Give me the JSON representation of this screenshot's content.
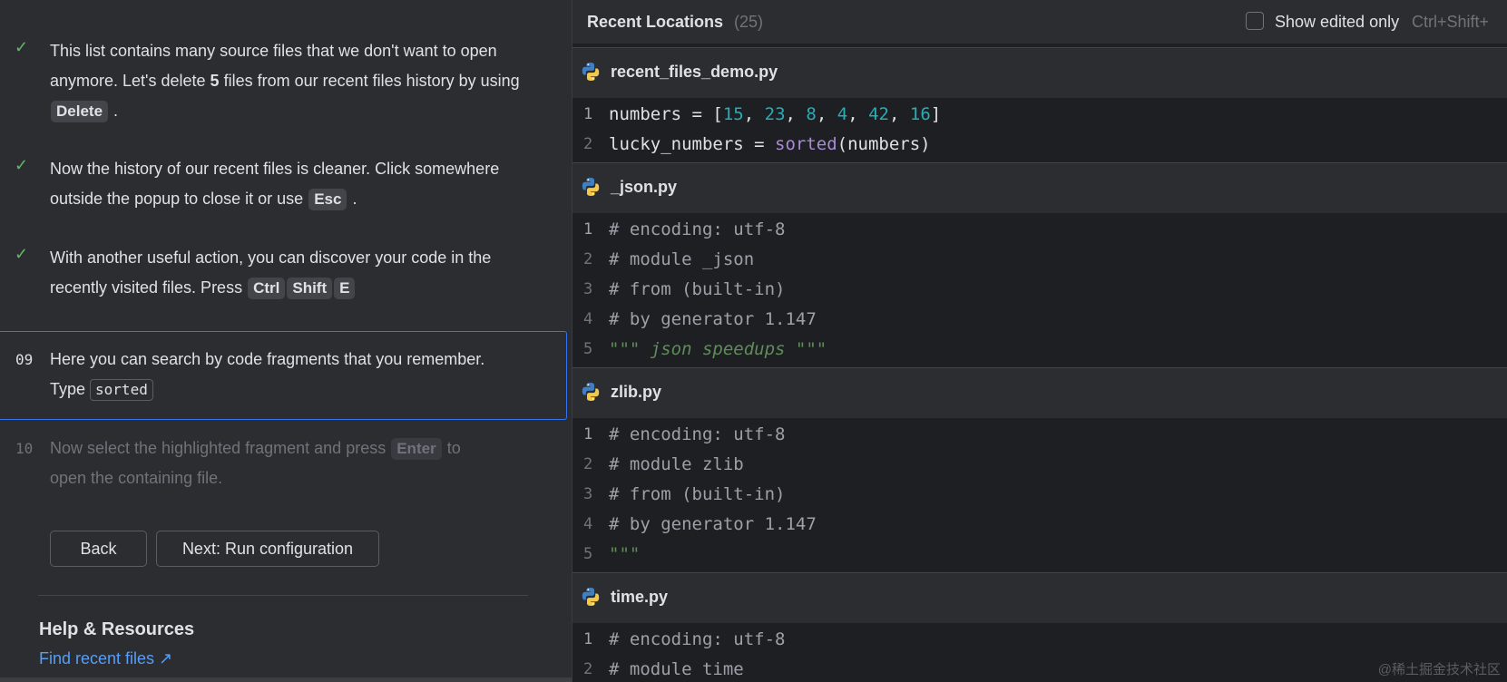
{
  "learn_panel": {
    "steps": [
      {
        "status": "done",
        "parts": [
          "This list contains many source files that we don't want to open anymore. Let's delete ",
          "5",
          " files from our recent files history by using "
        ],
        "key": "Delete",
        "after": " ."
      },
      {
        "status": "done",
        "text": "Now the history of our recent files is cleaner. Click somewhere outside the popup to close it or use ",
        "key": "Esc",
        "after": " ."
      },
      {
        "status": "done",
        "text": "With another useful action, you can discover your code in the recently visited files. Press ",
        "keys": [
          "Ctrl",
          "Shift",
          "E"
        ]
      },
      {
        "status": "current",
        "number": "09",
        "text_line1": "Here you can search by code fragments that you remember.",
        "text_line2": "Type ",
        "code": "sorted"
      },
      {
        "status": "pending",
        "number": "10",
        "text_a": "Now select the highlighted fragment and press ",
        "key": "Enter",
        "text_b": " to",
        "text_line2": "open the containing file."
      }
    ],
    "back_label": "Back",
    "next_label": "Next: Run configuration",
    "help_title": "Help & Resources",
    "help_link": "Find recent files ↗"
  },
  "popup": {
    "title": "Recent Locations",
    "count": "(25)",
    "show_edited_label": "Show edited only",
    "show_edited_shortcut": "Ctrl+Shift+",
    "show_edited_checked": false,
    "files": [
      {
        "name": "recent_files_demo.py",
        "icon": "python-icon",
        "lines": [
          {
            "n": "1",
            "tokens": [
              [
                "plain",
                "numbers = ["
              ],
              [
                "num",
                "15"
              ],
              [
                "plain",
                ", "
              ],
              [
                "num",
                "23"
              ],
              [
                "plain",
                ", "
              ],
              [
                "num",
                "8"
              ],
              [
                "plain",
                ", "
              ],
              [
                "num",
                "4"
              ],
              [
                "plain",
                ", "
              ],
              [
                "num",
                "42"
              ],
              [
                "plain",
                ", "
              ],
              [
                "num",
                "16"
              ],
              [
                "plain",
                "]"
              ]
            ]
          },
          {
            "n": "2",
            "tokens": [
              [
                "plain",
                "lucky_numbers = "
              ],
              [
                "fn",
                "sorted"
              ],
              [
                "plain",
                "(numbers)"
              ]
            ]
          }
        ]
      },
      {
        "name": "_json.py",
        "icon": "python-icon",
        "lines": [
          {
            "n": "1",
            "tokens": [
              [
                "com",
                "# encoding: utf-8"
              ]
            ]
          },
          {
            "n": "2",
            "tokens": [
              [
                "com",
                "# module _json"
              ]
            ]
          },
          {
            "n": "3",
            "tokens": [
              [
                "com",
                "# from (built-in)"
              ]
            ]
          },
          {
            "n": "4",
            "tokens": [
              [
                "com",
                "# by generator 1.147"
              ]
            ]
          },
          {
            "n": "5",
            "tokens": [
              [
                "doc",
                "\"\"\" json speedups \"\"\""
              ]
            ]
          }
        ]
      },
      {
        "name": "zlib.py",
        "icon": "python-icon",
        "lines": [
          {
            "n": "1",
            "tokens": [
              [
                "com",
                "# encoding: utf-8"
              ]
            ]
          },
          {
            "n": "2",
            "tokens": [
              [
                "com",
                "# module zlib"
              ]
            ]
          },
          {
            "n": "3",
            "tokens": [
              [
                "com",
                "# from (built-in)"
              ]
            ]
          },
          {
            "n": "4",
            "tokens": [
              [
                "com",
                "# by generator 1.147"
              ]
            ]
          },
          {
            "n": "5",
            "tokens": [
              [
                "doc",
                "\"\"\""
              ]
            ]
          }
        ]
      },
      {
        "name": "time.py",
        "icon": "python-icon",
        "lines": [
          {
            "n": "1",
            "tokens": [
              [
                "com",
                "# encoding: utf-8"
              ]
            ]
          },
          {
            "n": "2",
            "tokens": [
              [
                "com",
                "# module time"
              ]
            ]
          }
        ]
      }
    ]
  },
  "watermark": "@稀土掘金技术社区",
  "colors": {
    "accent": "#3574f0",
    "check": "#5fb865",
    "link": "#589df6",
    "number": "#2aacb8",
    "function": "#a88bd6",
    "docstring": "#5f8c5a"
  }
}
